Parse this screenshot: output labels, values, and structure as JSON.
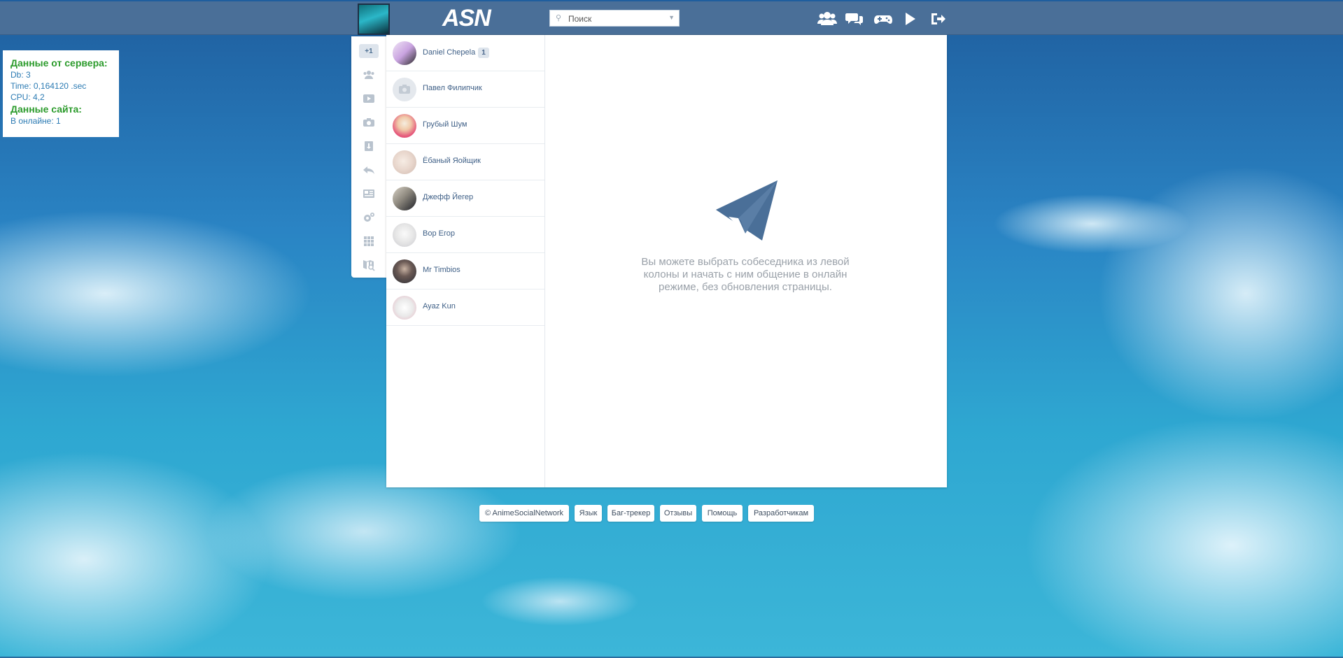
{
  "topbar": {
    "logo": "ASN",
    "search_placeholder": "Поиск",
    "icons": [
      "friends-icon",
      "messages-icon",
      "games-icon",
      "play-icon",
      "logout-icon"
    ]
  },
  "debug": {
    "server_heading": "Данные от сервера:",
    "db": "Db: 3",
    "time": "Time: 0,164120 .sec",
    "cpu": "CPU: 4,2",
    "site_heading": "Данные сайта:",
    "online": "В онлайне: 1"
  },
  "sidemenu": {
    "badge": "+1",
    "icons": [
      "groups-icon",
      "video-icon",
      "camera-icon",
      "download-icon",
      "reply-icon",
      "news-icon",
      "settings-icon",
      "apps-icon",
      "map-search-icon"
    ]
  },
  "dialogs": [
    {
      "name": "Daniel Chepela",
      "count": "1"
    },
    {
      "name": "Павел Филипчик",
      "count": ""
    },
    {
      "name": "Грубый Шум",
      "count": ""
    },
    {
      "name": "Ёбаный Яойщик",
      "count": ""
    },
    {
      "name": "Джефф Йегер",
      "count": ""
    },
    {
      "name": "Вор Егор",
      "count": ""
    },
    {
      "name": "Mr Timbios",
      "count": ""
    },
    {
      "name": "Ayaz Kun",
      "count": ""
    }
  ],
  "placeholder_text": "Вы можете выбрать собеседника из левой колоны и начать с ним общение в онлайн режиме, без обновления страницы.",
  "footer": {
    "links": [
      "© AnimeSocialNetwork",
      "Язык",
      "Баг-трекер",
      "Отзывы",
      "Помощь",
      "Разработчикам"
    ]
  },
  "colors": {
    "topbar": "#4a6f98",
    "accent": "#3e5f86",
    "debug_heading": "#2c9b2c",
    "debug_text": "#2c7bb3"
  }
}
